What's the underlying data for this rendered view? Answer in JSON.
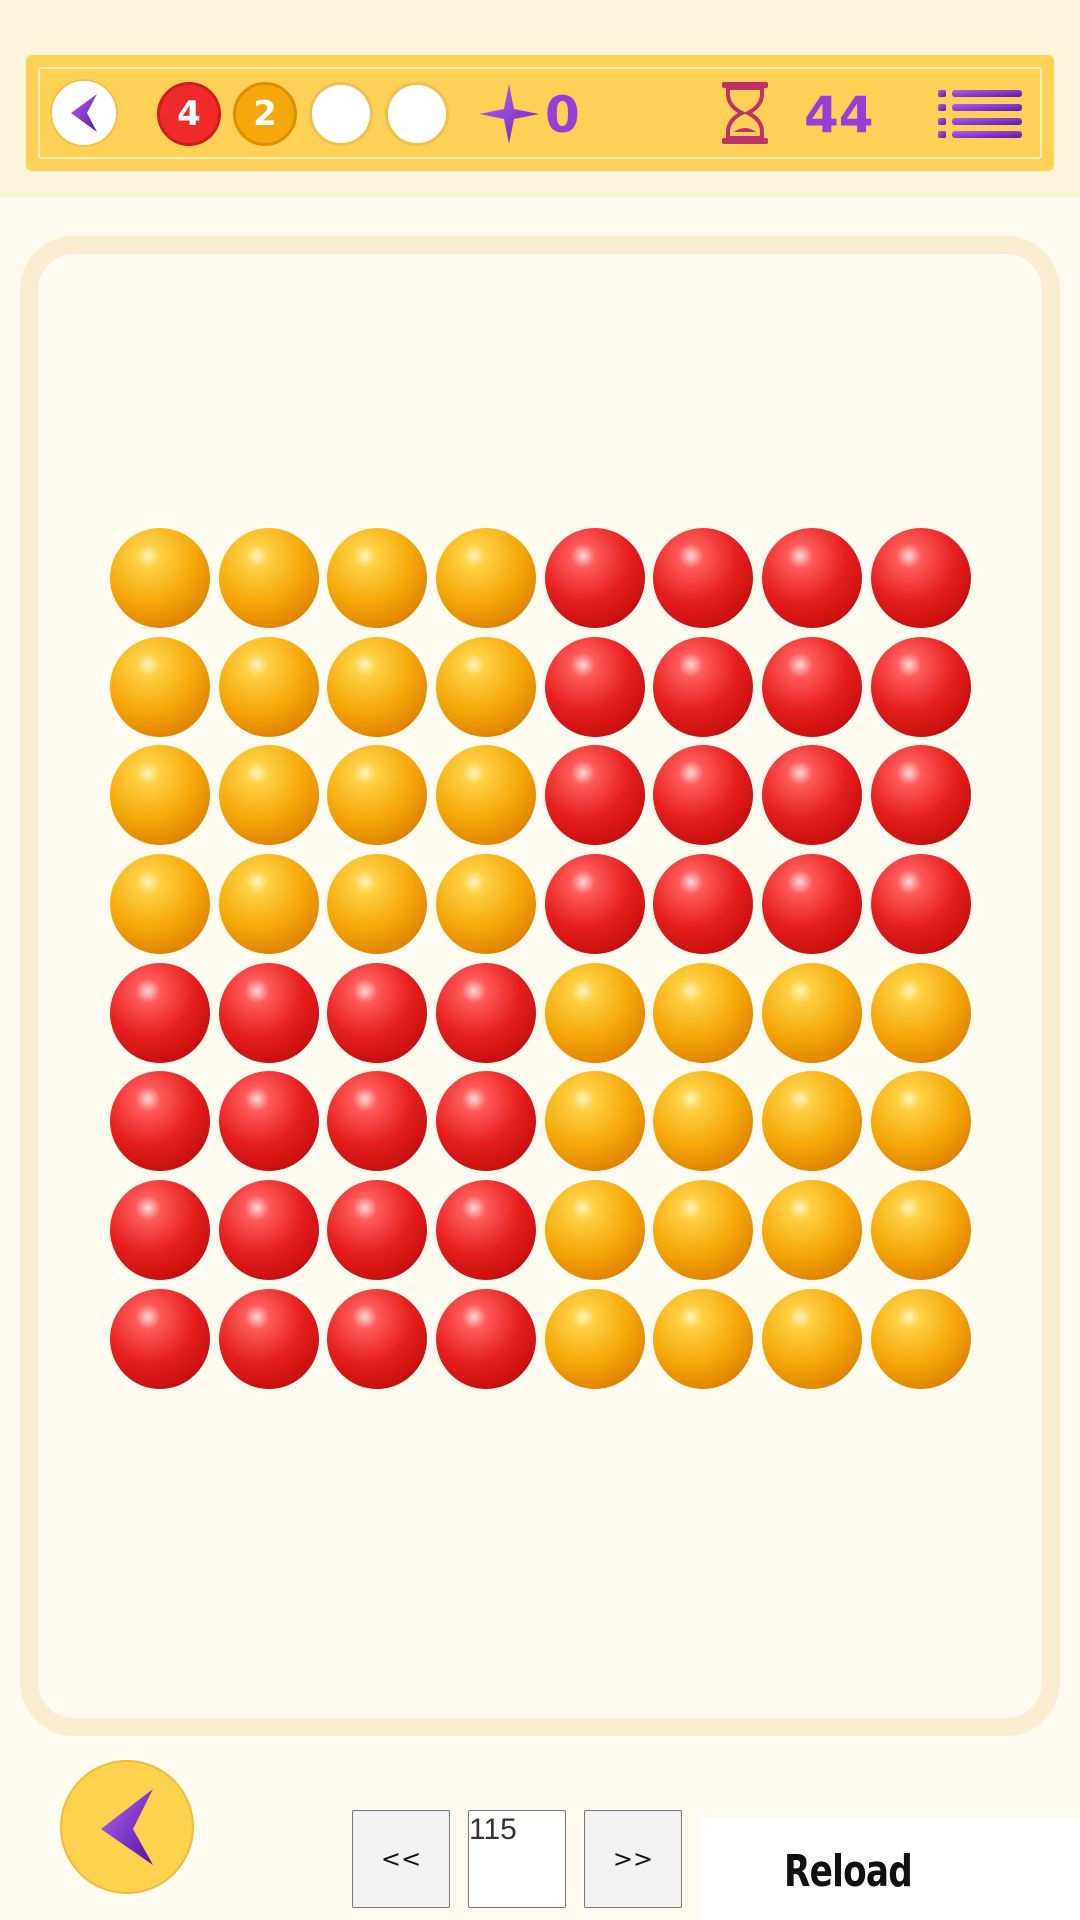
{
  "header": {
    "badges": {
      "red_count": "4",
      "orange_count": "2"
    },
    "score": "0",
    "timer": "44",
    "icons": {
      "back": "back-arrow-icon",
      "star": "star-icon",
      "hourglass": "hourglass-icon",
      "menu": "menu-icon"
    }
  },
  "board": {
    "rows": [
      [
        "orange",
        "orange",
        "orange",
        "orange",
        "red",
        "red",
        "red",
        "red"
      ],
      [
        "orange",
        "orange",
        "orange",
        "orange",
        "red",
        "red",
        "red",
        "red"
      ],
      [
        "orange",
        "orange",
        "orange",
        "orange",
        "red",
        "red",
        "red",
        "red"
      ],
      [
        "orange",
        "orange",
        "orange",
        "orange",
        "red",
        "red",
        "red",
        "red"
      ],
      [
        "red",
        "red",
        "red",
        "red",
        "orange",
        "orange",
        "orange",
        "orange"
      ],
      [
        "red",
        "red",
        "red",
        "red",
        "orange",
        "orange",
        "orange",
        "orange"
      ],
      [
        "red",
        "red",
        "red",
        "red",
        "orange",
        "orange",
        "orange",
        "orange"
      ],
      [
        "red",
        "red",
        "red",
        "red",
        "orange",
        "orange",
        "orange",
        "orange"
      ]
    ]
  },
  "footer": {
    "prev_label": "<<",
    "page_value": "115",
    "next_label": ">>",
    "reload_label": "Reload"
  },
  "colors": {
    "header_bg": "#fed156",
    "accent_purple": "#9a3dd6",
    "orange_ball": "#f5a90a",
    "red_ball": "#e61e1e"
  }
}
